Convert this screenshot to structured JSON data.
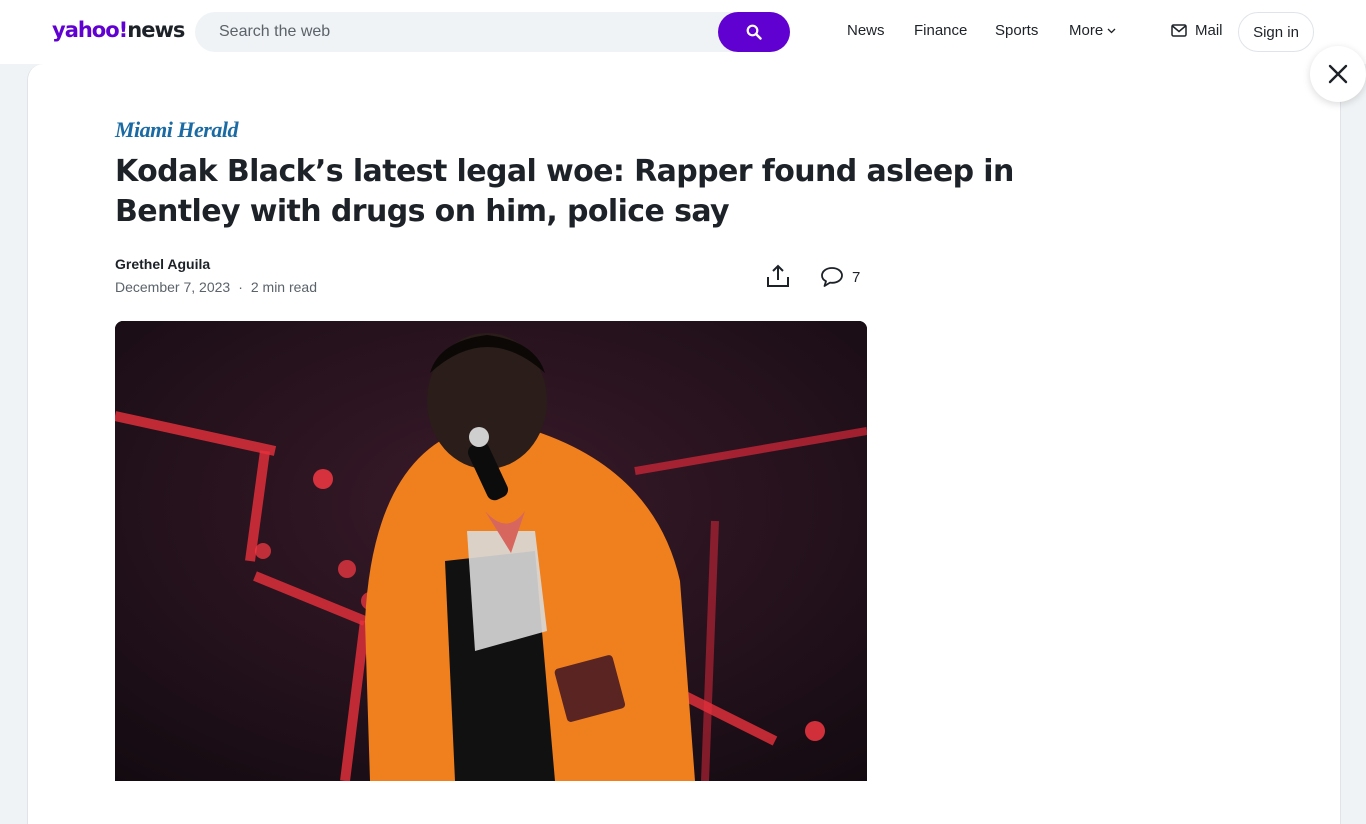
{
  "header": {
    "logo_yahoo": "yahoo!",
    "logo_news": "news",
    "search_placeholder": "Search the web",
    "nav": [
      "News",
      "Finance",
      "Sports",
      "More"
    ],
    "mail_label": "Mail",
    "signin_label": "Sign in"
  },
  "article": {
    "publisher": "Miami Herald",
    "headline": "Kodak Black’s latest legal woe: Rapper found asleep in Bentley with drugs on him, police say",
    "author": "Grethel Aguila",
    "date": "December 7, 2023",
    "separator": "·",
    "read_time": "2 min read",
    "comment_count": "7"
  },
  "colors": {
    "brand": "#6001d2",
    "text": "#1d2228",
    "muted": "#5b636a",
    "publisher": "#1a6aa3"
  },
  "icons": [
    "search-icon",
    "chevron-down-icon",
    "mail-icon",
    "close-icon",
    "share-icon",
    "comment-icon"
  ]
}
